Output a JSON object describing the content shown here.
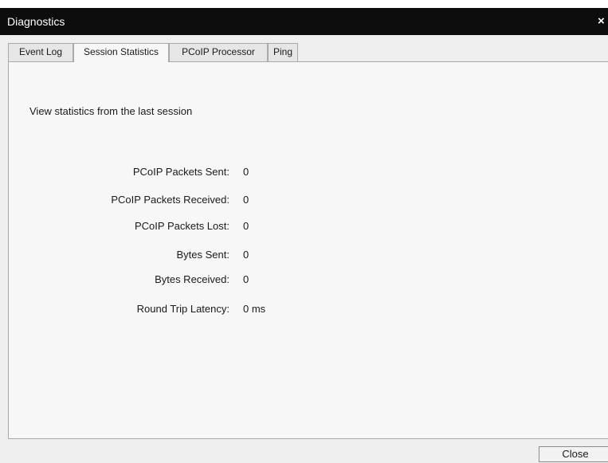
{
  "window": {
    "title": "Diagnostics",
    "close_glyph": "×"
  },
  "tabs": [
    {
      "label": "Event Log",
      "active": false
    },
    {
      "label": "Session Statistics",
      "active": true
    },
    {
      "label": "PCoIP Processor",
      "active": false
    },
    {
      "label": "Ping",
      "active": false
    }
  ],
  "panel": {
    "intro": "View statistics from the last session",
    "stats": [
      {
        "label": "PCoIP Packets Sent:",
        "value": "0"
      },
      {
        "label": "PCoIP Packets Received:",
        "value": "0"
      },
      {
        "label": "PCoIP Packets Lost:",
        "value": "0"
      },
      {
        "label": "Bytes Sent:",
        "value": "0"
      },
      {
        "label": "Bytes Received:",
        "value": "0"
      },
      {
        "label": "Round Trip Latency:",
        "value": "0 ms"
      }
    ]
  },
  "footer": {
    "close_label": "Close"
  },
  "colors": {
    "titlebar": "#0d0d0d",
    "window_bg": "#efefef",
    "panel_bg": "#f7f7f7",
    "border": "#a9a9a9"
  }
}
